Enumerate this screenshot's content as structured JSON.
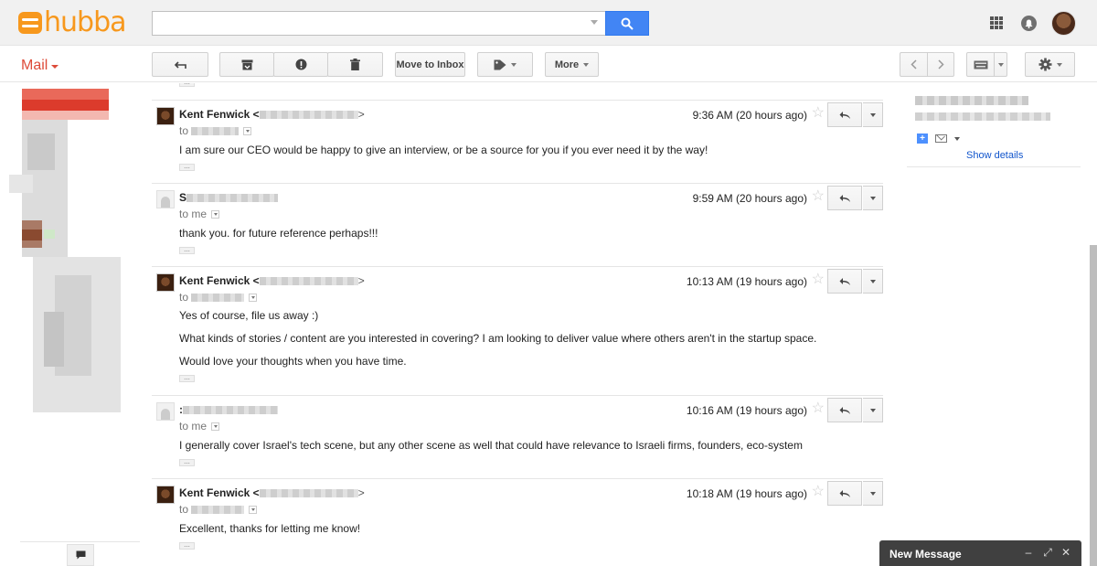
{
  "header": {
    "logo_text": "hubba",
    "search": {
      "value": "",
      "placeholder": ""
    },
    "icons": {
      "apps": "apps-grid-icon",
      "notifications": "notifications-icon",
      "search": "search-icon"
    }
  },
  "toolbar": {
    "mail_label": "Mail",
    "move_to_inbox_label": "Move to Inbox",
    "more_label": "More"
  },
  "thread": {
    "messages": [
      {
        "sender": "Kent Fenwick",
        "sender_prefix": "Kent Fenwick <",
        "sender_suffix": ">",
        "to_prefix": "to",
        "time": "9:36 AM (20 hours ago)",
        "body": [
          "I am sure our CEO would be happy to give an interview, or be a source for you if you ever need it by the way!"
        ]
      },
      {
        "sender_initial": "S",
        "to_prefix": "to me",
        "time": "9:59 AM (20 hours ago)",
        "body": [
          "thank you. for future reference perhaps!!!"
        ]
      },
      {
        "sender": "Kent Fenwick",
        "sender_prefix": "Kent Fenwick <",
        "sender_suffix": ">",
        "to_prefix": "to",
        "time": "10:13 AM (19 hours ago)",
        "body": [
          "Yes of course, file us away :)",
          "What kinds of stories / content are you interested in covering? I am looking to deliver value where others aren't in the startup space.",
          "Would love your thoughts when you have time."
        ]
      },
      {
        "sender_initial": ":",
        "to_prefix": "to me",
        "time": "10:16 AM (19 hours ago)",
        "body": [
          "I generally cover Israel's tech scene, but any other scene as well that could have relevance to Israeli firms, founders, eco-system"
        ]
      },
      {
        "sender": "Kent Fenwick",
        "sender_prefix": "Kent Fenwick <",
        "sender_suffix": ">",
        "to_prefix": "to",
        "time": "10:18 AM (19 hours ago)",
        "body": [
          "Excellent, thanks for letting me know!"
        ]
      }
    ]
  },
  "right_panel": {
    "show_details_label": "Show details"
  },
  "compose": {
    "title": "New Message"
  },
  "colors": {
    "brand_orange": "#f7981d",
    "mail_red": "#dd4b39",
    "search_blue": "#4285f4",
    "compose_bg": "#404040",
    "link_blue": "#1155cc"
  }
}
